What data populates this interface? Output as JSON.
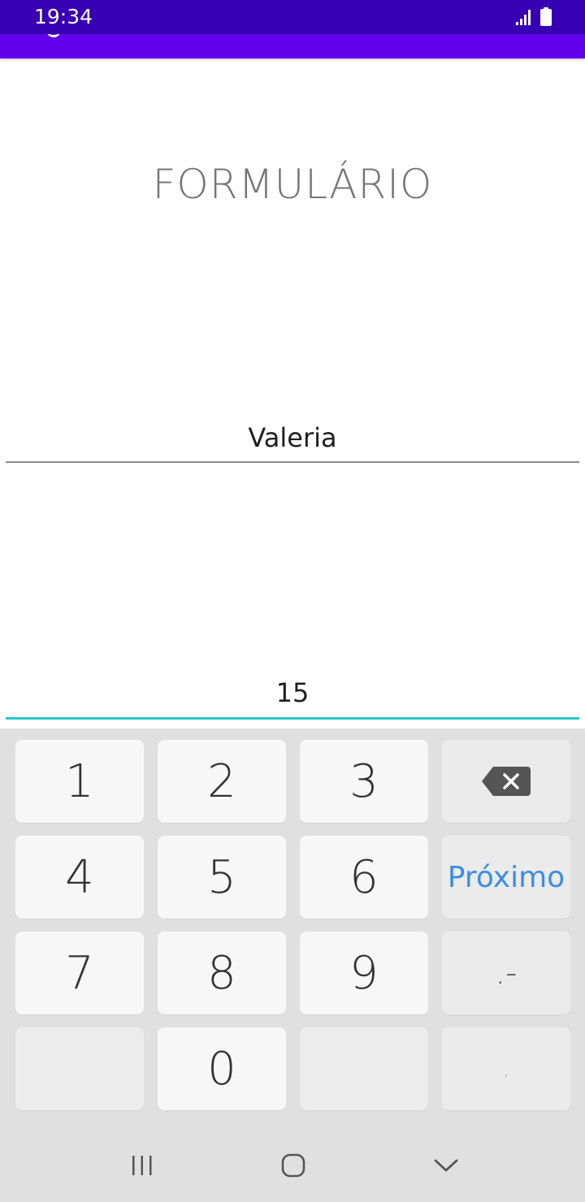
{
  "status_bar": {
    "time": "19:34"
  },
  "form": {
    "title": "FORMULÁRIO",
    "name_value": "Valeria",
    "age_value": "15"
  },
  "keyboard": {
    "keys": [
      "1",
      "2",
      "3",
      "4",
      "5",
      "6",
      "7",
      "8",
      "9",
      "0"
    ],
    "next_label": "Próximo",
    "dot_dash": ".-",
    "comma": ",",
    "backspace_icon": "backspace-icon"
  },
  "nav": {
    "recents_icon": "recents-icon",
    "home_icon": "home-icon",
    "hide_keyboard_icon": "chevron-down-icon"
  },
  "colors": {
    "status_bar": "#3700b3",
    "app_bar": "#6200ee",
    "focus_underline": "#26c6c6",
    "next_key_text": "#3a8ee6"
  }
}
